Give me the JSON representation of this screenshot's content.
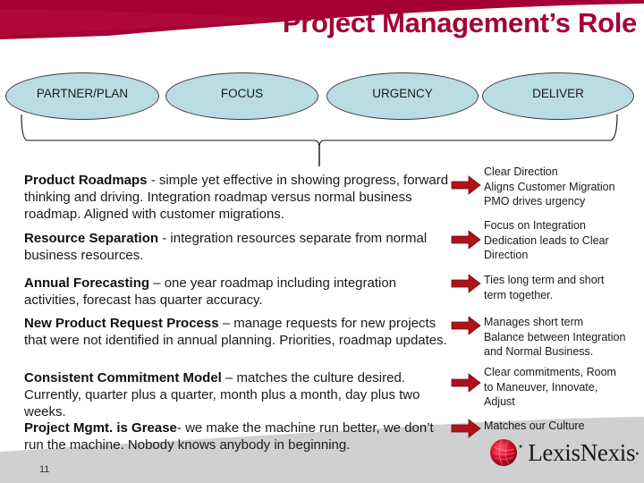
{
  "slide": {
    "title": "Project Management’s Role",
    "page_number": "11",
    "colors": {
      "brand_red": "#a50034",
      "oval_fill": "#b9dde3",
      "footer_gray": "#cfd0d2",
      "arrow_red": "#b0121b"
    }
  },
  "ovals": [
    {
      "label": "PARTNER/PLAN"
    },
    {
      "label": "FOCUS"
    },
    {
      "label": "URGENCY"
    },
    {
      "label": "DELIVER"
    }
  ],
  "left_items": [
    {
      "heading": "Product Roadmaps",
      "text": " -  simple yet effective in showing progress, forward thinking and driving.  Integration roadmap versus normal business roadmap.  Aligned with customer migrations."
    },
    {
      "heading": "Resource Separation",
      "text": " -  integration resources separate from normal business resources."
    },
    {
      "heading": "Annual Forecasting",
      "text": " – one year roadmap including integration activities, forecast has quarter accuracy."
    },
    {
      "heading": "New Product Request Process",
      "text": " – manage requests for new projects that were not identified in annual planning.  Priorities, roadmap updates."
    },
    {
      "heading": "Consistent Commitment Model",
      "text": " – matches the culture desired.  Currently, quarter plus a quarter, month plus a month, day plus two weeks."
    },
    {
      "heading": "Project Mgmt. is Grease",
      "text": "-  we make the machine run better, we don’t run the machine.  Nobody knows anybody in beginning."
    }
  ],
  "right_items": [
    {
      "lines": [
        "Clear Direction",
        "Aligns Customer Migration",
        "PMO drives urgency"
      ]
    },
    {
      "lines": [
        "Focus on Integration",
        "Dedication leads to Clear",
        "Direction"
      ]
    },
    {
      "lines": [
        "Ties long term and short",
        "term together."
      ]
    },
    {
      "lines": [
        "Manages short term",
        "Balance between Integration",
        "and Normal Business."
      ]
    },
    {
      "lines": [
        "Clear commitments, Room",
        "to Maneuver, Innovate,",
        "Adjust"
      ]
    },
    {
      "lines": [
        "Matches our Culture"
      ]
    }
  ],
  "logo": {
    "name": "LexisNexis",
    "icon": "lexisnexis-globe-icon"
  }
}
